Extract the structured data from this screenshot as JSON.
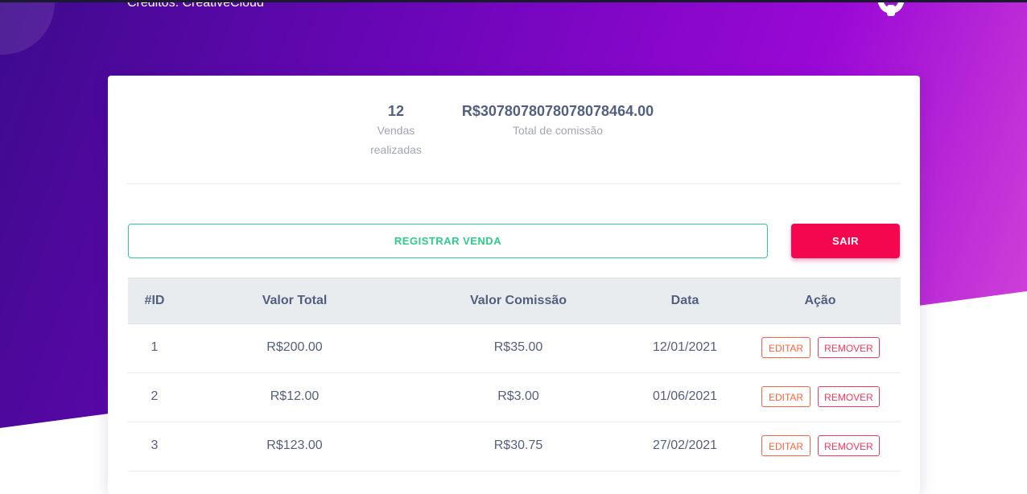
{
  "header": {
    "credits": "Créditos: CreativeCloud",
    "logo_icon": "github-icon"
  },
  "stats": {
    "sales_count": "12",
    "sales_label": "Vendas realizadas",
    "commission_total": "R$3078078078078078464.00",
    "commission_label": "Total de comissão"
  },
  "actions": {
    "register_label": "REGISTRAR VENDA",
    "exit_label": "SAIR"
  },
  "table": {
    "headers": [
      "#ID",
      "Valor Total",
      "Valor Comissão",
      "Data",
      "Ação"
    ],
    "rows": [
      {
        "id": "1",
        "total": "R$200.00",
        "commission": "R$35.00",
        "date": "12/01/2021",
        "edit": "EDITAR",
        "remove": "REMOVER"
      },
      {
        "id": "2",
        "total": "R$12.00",
        "commission": "R$3.00",
        "date": "01/06/2021",
        "edit": "EDITAR",
        "remove": "REMOVER"
      },
      {
        "id": "3",
        "total": "R$123.00",
        "commission": "R$30.75",
        "date": "27/02/2021",
        "edit": "EDITAR",
        "remove": "REMOVER"
      }
    ]
  },
  "colors": {
    "gradient_start": "#3d0a8c",
    "gradient_end": "#d94cd8",
    "success": "#2dce89",
    "danger": "#f5074f",
    "edit": "#fb6340",
    "remove": "#f5365c"
  }
}
